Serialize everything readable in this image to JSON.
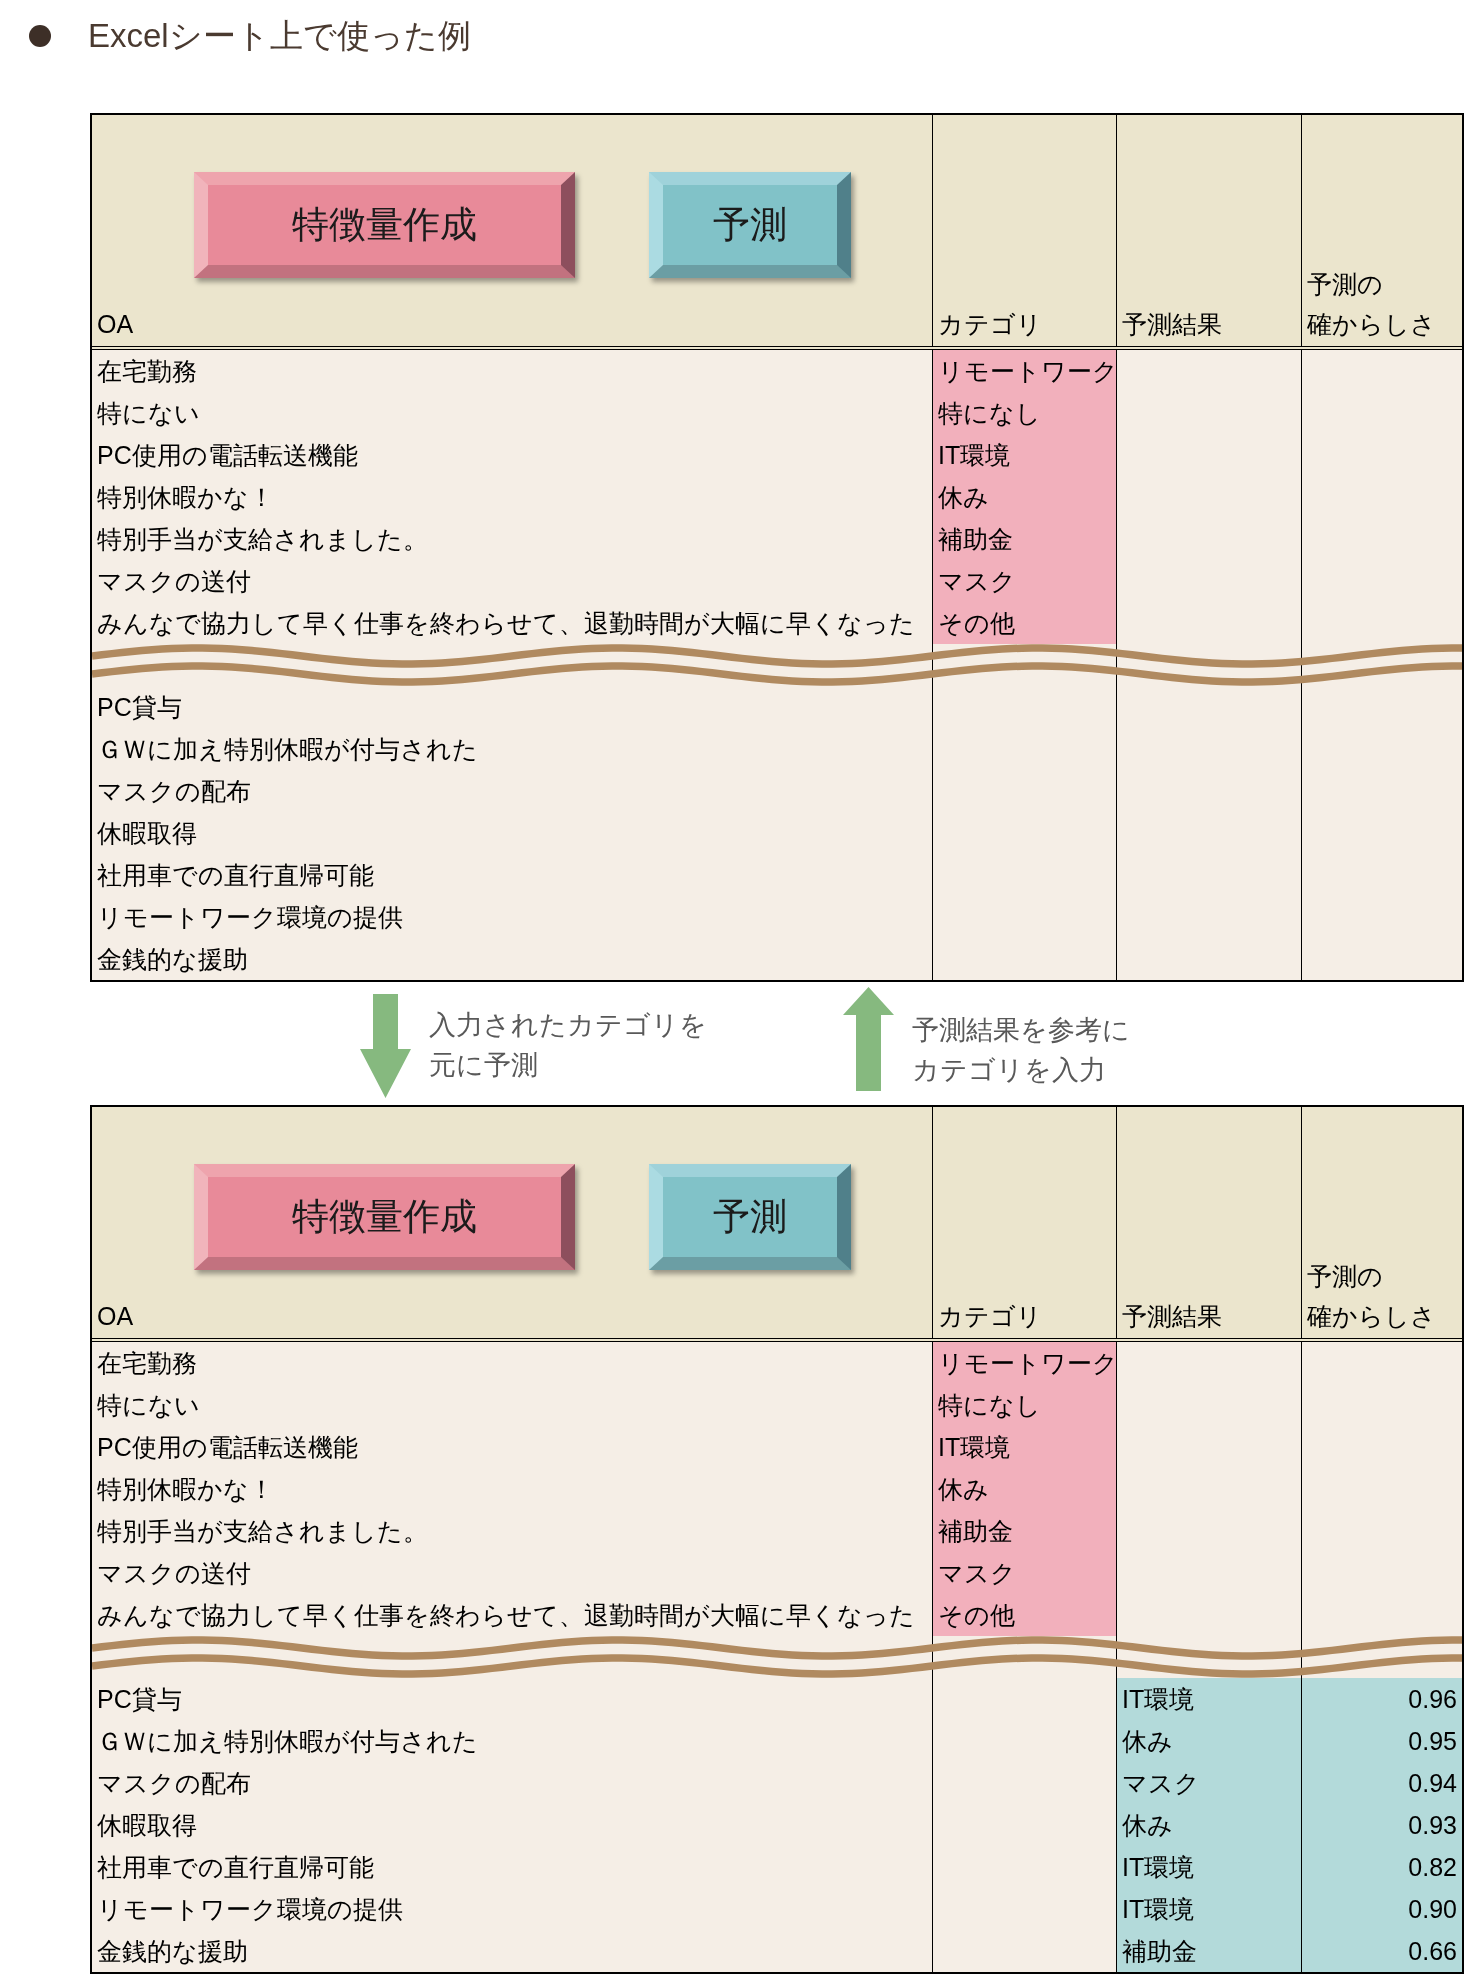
{
  "heading": {
    "text": "Excelシート上で使った例"
  },
  "panels": [
    {
      "kind": "sheet",
      "buttons": [
        {
          "kind": "feature",
          "label": "特徴量作成"
        },
        {
          "kind": "predict",
          "label": "予測"
        }
      ],
      "columns": [
        {
          "lines": [
            "OA"
          ]
        },
        {
          "lines": [
            "カテゴリ"
          ]
        },
        {
          "lines": [
            "予測結果"
          ]
        },
        {
          "lines": [
            "予測の",
            "確からしさ"
          ]
        }
      ],
      "row_groups": [
        {
          "rows": [
            {
              "oa": "在宅勤務",
              "category": "リモートワーク"
            },
            {
              "oa": "特にない",
              "category": "特になし"
            },
            {
              "oa": "PC使用の電話転送機能",
              "category": "IT環境"
            },
            {
              "oa": "特別休暇かな！",
              "category": "休み"
            },
            {
              "oa": "特別手当が支給されました。",
              "category": "補助金"
            },
            {
              "oa": "マスクの送付",
              "category": "マスク"
            },
            {
              "oa": "みんなで協力して早く仕事を終わらせて、退勤時間が大幅に早くなった",
              "category": "その他"
            }
          ]
        },
        {
          "rows": [
            {
              "oa": "PC貸与"
            },
            {
              "oa": "ＧＷに加え特別休暇が付与された"
            },
            {
              "oa": "マスクの配布"
            },
            {
              "oa": "休暇取得"
            },
            {
              "oa": "社用車での直行直帰可能"
            },
            {
              "oa": "リモートワーク環境の提供"
            },
            {
              "oa": "金銭的な援助"
            }
          ]
        }
      ]
    },
    {
      "kind": "flow",
      "arrows": [
        {
          "kind": "down",
          "lines": [
            "入力されたカテゴリを",
            "元に予測"
          ]
        },
        {
          "kind": "up",
          "lines": [
            "予測結果を参考に",
            "カテゴリを入力"
          ]
        }
      ]
    },
    {
      "kind": "sheet",
      "buttons": [
        {
          "kind": "feature",
          "label": "特徴量作成"
        },
        {
          "kind": "predict",
          "label": "予測"
        }
      ],
      "columns": [
        {
          "lines": [
            "OA"
          ]
        },
        {
          "lines": [
            "カテゴリ"
          ]
        },
        {
          "lines": [
            "予測結果"
          ]
        },
        {
          "lines": [
            "予測の",
            "確からしさ"
          ]
        }
      ],
      "row_groups": [
        {
          "rows": [
            {
              "oa": "在宅勤務",
              "category": "リモートワーク"
            },
            {
              "oa": "特にない",
              "category": "特になし"
            },
            {
              "oa": "PC使用の電話転送機能",
              "category": "IT環境"
            },
            {
              "oa": "特別休暇かな！",
              "category": "休み"
            },
            {
              "oa": "特別手当が支給されました。",
              "category": "補助金"
            },
            {
              "oa": "マスクの送付",
              "category": "マスク"
            },
            {
              "oa": "みんなで協力して早く仕事を終わらせて、退勤時間が大幅に早くなった",
              "category": "その他"
            }
          ]
        },
        {
          "rows": [
            {
              "oa": "PC貸与",
              "prediction": "IT環境",
              "confidence": "0.96"
            },
            {
              "oa": "ＧＷに加え特別休暇が付与された",
              "prediction": "休み",
              "confidence": "0.95"
            },
            {
              "oa": "マスクの配布",
              "prediction": "マスク",
              "confidence": "0.94"
            },
            {
              "oa": "休暇取得",
              "prediction": "休み",
              "confidence": "0.93"
            },
            {
              "oa": "社用車での直行直帰可能",
              "prediction": "IT環境",
              "confidence": "0.82"
            },
            {
              "oa": "リモートワーク環境の提供",
              "prediction": "IT環境",
              "confidence": "0.90"
            },
            {
              "oa": "金銭的な援助",
              "prediction": "補助金",
              "confidence": "0.66"
            }
          ]
        }
      ]
    }
  ]
}
